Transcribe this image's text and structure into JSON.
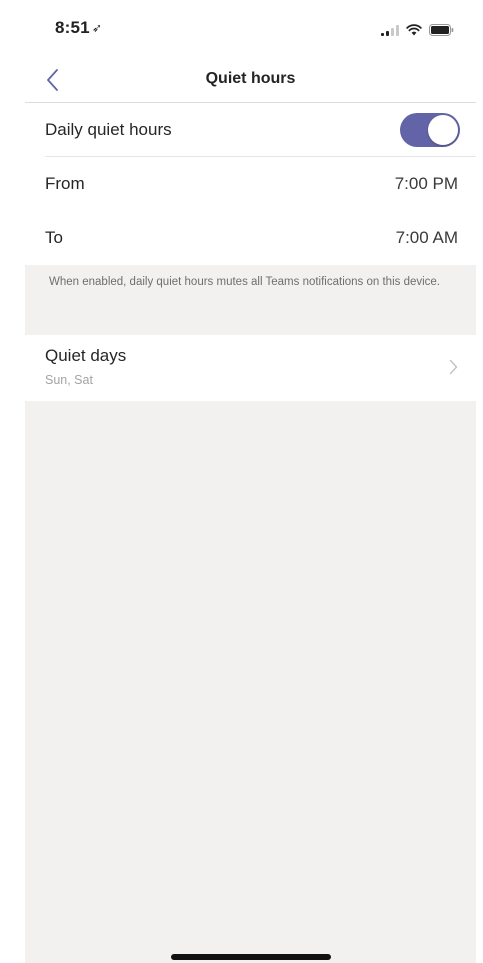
{
  "status_bar": {
    "time": "8:51",
    "location_icon": "location-arrow-icon",
    "signal_icon": "cellular-signal-icon",
    "wifi_icon": "wifi-icon",
    "battery_icon": "battery-icon"
  },
  "nav": {
    "title": "Quiet hours",
    "back_icon": "chevron-left-icon"
  },
  "settings": {
    "daily_quiet_hours": {
      "label": "Daily quiet hours",
      "enabled": true
    },
    "from": {
      "label": "From",
      "value": "7:00 PM"
    },
    "to": {
      "label": "To",
      "value": "7:00 AM"
    },
    "footnote": "When enabled, daily quiet hours mutes all Teams notifications on this device.",
    "quiet_days": {
      "label": "Quiet days",
      "value": "Sun, Sat",
      "chevron_icon": "chevron-right-icon"
    }
  },
  "colors": {
    "accent": "#6264a7",
    "background": "#f3f1f0",
    "surface": "#ffffff"
  }
}
